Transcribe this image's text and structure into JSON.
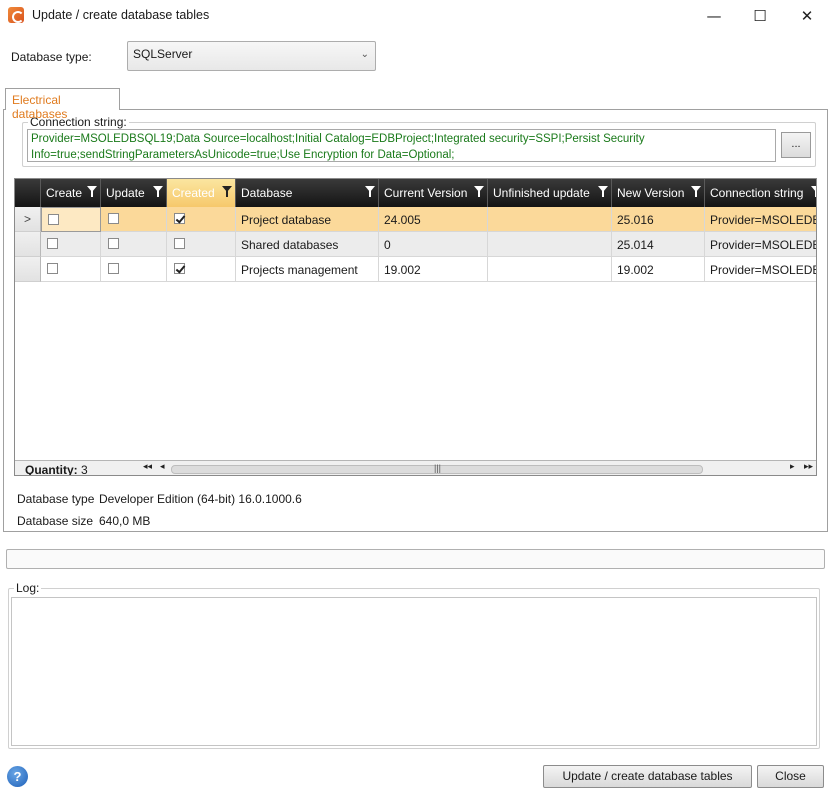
{
  "window": {
    "title": "Update / create database tables",
    "minimize_glyph": "—",
    "maximize_glyph": "☐",
    "close_glyph": "✕"
  },
  "db_type": {
    "label": "Database type:",
    "selected": "SQLServer"
  },
  "tab": {
    "label": "Electrical databases"
  },
  "connection": {
    "label": "Connection string:",
    "value": "Provider=MSOLEDBSQL19;Data Source=localhost;Initial Catalog=EDBProject;Integrated security=SSPI;Persist Security Info=true;sendStringParametersAsUnicode=true;Use Encryption for Data=Optional;",
    "browse_label": "..."
  },
  "grid": {
    "columns": [
      "Create",
      "Update",
      "Created",
      "Database",
      "Current Version",
      "Unfinished update",
      "New Version",
      "Connection string"
    ],
    "rows": [
      {
        "indicator": ">",
        "create": false,
        "update": false,
        "created": true,
        "database": "Project database",
        "current_version": "24.005",
        "unfinished_update": "",
        "new_version": "25.016",
        "connection_string": "Provider=MSOLEDB"
      },
      {
        "indicator": "",
        "create": false,
        "update": false,
        "created": false,
        "database": "Shared databases",
        "current_version": "0",
        "unfinished_update": "",
        "new_version": "25.014",
        "connection_string": "Provider=MSOLEDB"
      },
      {
        "indicator": "",
        "create": false,
        "update": false,
        "created": true,
        "database": "Projects management",
        "current_version": "19.002",
        "unfinished_update": "",
        "new_version": "19.002",
        "connection_string": "Provider=MSOLEDB"
      }
    ],
    "quantity_label": "Quantity:",
    "quantity_value": "3"
  },
  "info": {
    "type_label": "Database type",
    "type_value": "Developer Edition (64-bit) 16.0.1000.6",
    "size_label": "Database size",
    "size_value": "640,0 MB"
  },
  "log": {
    "label": "Log:"
  },
  "buttons": {
    "update": "Update / create database tables",
    "close": "Close",
    "help": "?"
  },
  "colors": {
    "accent": "#e07b1f",
    "connection_text": "#1a7a1a",
    "header_bg": "#1e1e1e",
    "selected_row": "#fbd99a"
  }
}
